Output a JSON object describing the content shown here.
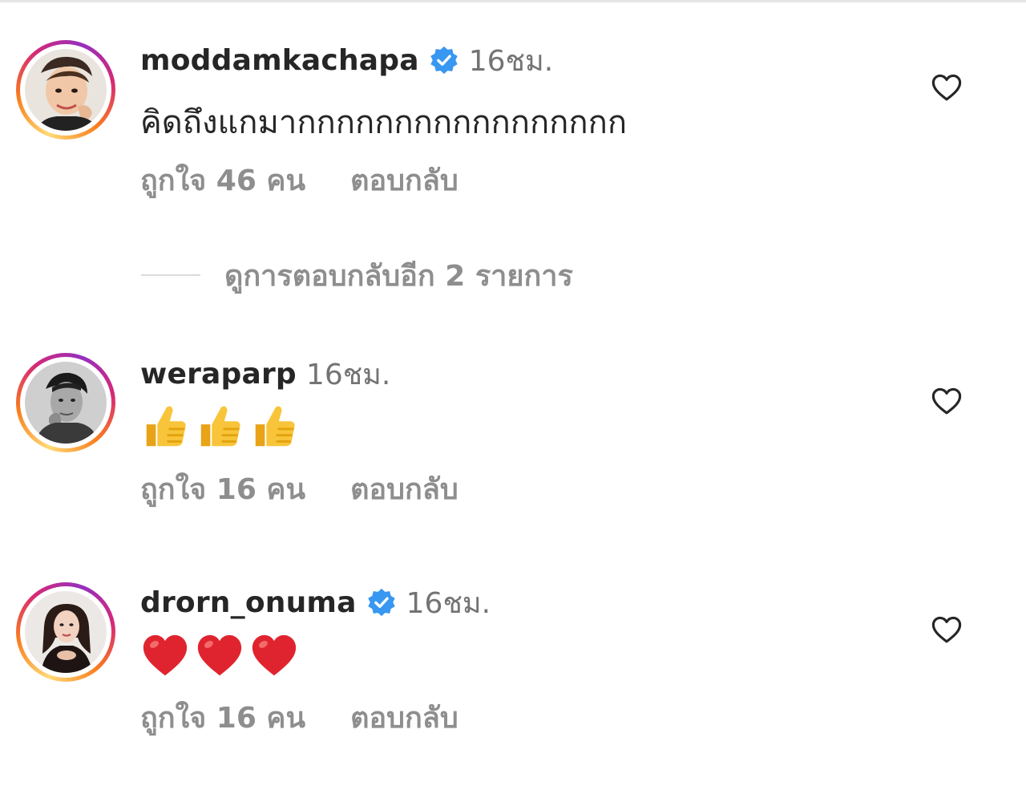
{
  "comments": [
    {
      "username": "moddamkachapa",
      "verified": true,
      "time": "16ชม.",
      "text": "คิดถึงแกมากกกกกกกกกกกกกกกกก",
      "likes": "ถูกใจ 46 คน",
      "reply": "ตอบกลับ",
      "avatar_icon": "avatar-man-smiling"
    },
    {
      "username": "weraparp",
      "verified": false,
      "time": "16ชม.",
      "emojis": [
        "👍",
        "👍",
        "👍"
      ],
      "likes": "ถูกใจ 16 คน",
      "reply": "ตอบกลับ",
      "avatar_icon": "avatar-man-bw"
    },
    {
      "username": "drorn_onuma",
      "verified": true,
      "time": "16ชม.",
      "emojis": [
        "❤️",
        "❤️",
        "❤️"
      ],
      "likes": "ถูกใจ 16 คน",
      "reply": "ตอบกลับ",
      "avatar_icon": "avatar-woman"
    }
  ],
  "view_more_replies": "ดูการตอบกลับอีก 2 รายการ",
  "colors": {
    "verified_blue": "#3897f0",
    "secondary_text": "#8e8e8e",
    "primary_text": "#262626"
  }
}
